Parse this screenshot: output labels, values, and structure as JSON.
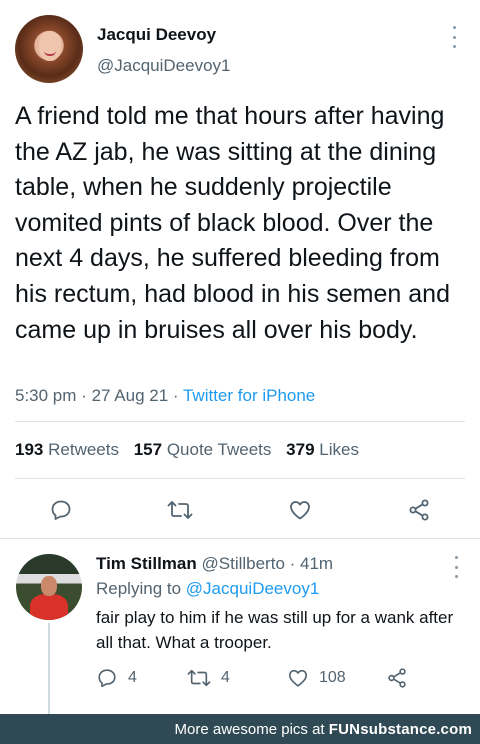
{
  "main_tweet": {
    "display_name": "Jacqui Deevoy",
    "handle": "@JacquiDeevoy1",
    "text": "A friend told me that hours after having the AZ jab, he was sitting at the dining table, when he suddenly projectile vomited pints of black blood. Over the next 4 days, he suffered bleeding from his rectum, had blood in his semen and came up in bruises all over his body.",
    "time": "5:30 pm",
    "date": "27 Aug 21",
    "separator": "·",
    "source": "Twitter for iPhone",
    "stats": {
      "retweets_count": "193",
      "retweets_label": "Retweets",
      "quotes_count": "157",
      "quotes_label": "Quote Tweets",
      "likes_count": "379",
      "likes_label": "Likes"
    },
    "actions": [
      "reply-icon",
      "retweet-icon",
      "like-icon",
      "share-icon"
    ]
  },
  "reply_tweet": {
    "display_name": "Tim Stillman",
    "handle": "@Stillberto",
    "age": "· 41m",
    "replying_prefix": "Replying to",
    "replying_to": "@JacquiDeevoy1",
    "text": "fair play to him if he was still up for a wank after all that. What a trooper.",
    "reply_count": "4",
    "retweet_count": "4",
    "like_count": "108"
  },
  "footer": {
    "prefix": "More awesome pics at",
    "brand": "FUNsubstance.com"
  },
  "colors": {
    "link": "#1d9bf0",
    "muted": "#536471",
    "text": "#0f1419",
    "footer_bg": "#2f4a54"
  }
}
